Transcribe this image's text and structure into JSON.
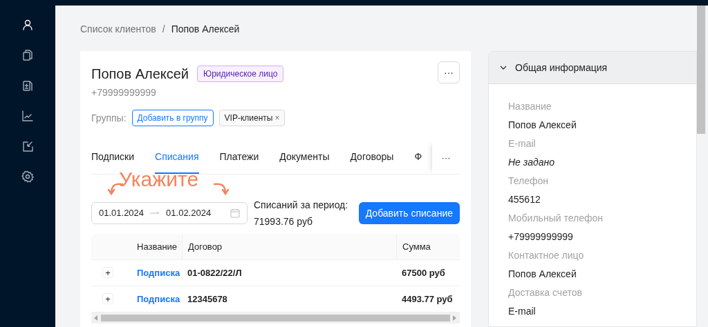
{
  "sidebar": {
    "items": [
      {
        "kind": "user",
        "selected": true
      },
      {
        "kind": "documents",
        "selected": false
      },
      {
        "kind": "invoice",
        "selected": false
      },
      {
        "kind": "chart",
        "selected": false
      },
      {
        "kind": "edit",
        "selected": false
      },
      {
        "kind": "settings",
        "selected": false
      }
    ]
  },
  "breadcrumbs": [
    "Список клиентов",
    "/",
    "Попов Алексей"
  ],
  "client": {
    "name": "Попов Алексей",
    "badge": "Юридическое лицо",
    "phone": "+79999999999",
    "more": "···",
    "groups_label": "Группы:",
    "add_group": "Добавить в группу",
    "groups": [
      {
        "label": "VIP-клиенты",
        "close": "×"
      }
    ]
  },
  "tabs": [
    {
      "label": "Подписки",
      "selected": false
    },
    {
      "label": "Списания",
      "selected": true
    },
    {
      "label": "Платежи",
      "selected": false
    },
    {
      "label": "Документы",
      "selected": false
    },
    {
      "label": "Договоры",
      "selected": false
    },
    {
      "label": "Ф",
      "selected": false
    }
  ],
  "tabs_more": "···",
  "annotation": "Укажите",
  "date_range": {
    "from": "01.01.2024",
    "to": "01.02.2024"
  },
  "period_total": {
    "label": "Списаний за период:",
    "value": "71993.76 руб"
  },
  "add_button": "Добавить списание",
  "table": {
    "columns": [
      "Название",
      "Договор",
      "Сумма"
    ],
    "rows": [
      {
        "expand": "+",
        "name": "Подписка",
        "contract": "01-0822/22/Л",
        "amount": "67500 руб"
      },
      {
        "expand": "+",
        "name": "Подписка",
        "contract": "12345678",
        "amount": "4493.77 руб"
      }
    ]
  },
  "info_panel": {
    "title": "Общая информация",
    "expanded": true,
    "fields": [
      {
        "label": "Название",
        "value": "Попов Алексей",
        "empty": false
      },
      {
        "label": "E-mail",
        "value": "Не задано",
        "empty": true
      },
      {
        "label": "Телефон",
        "value": "455612",
        "empty": false
      },
      {
        "label": "Мобильный телефон",
        "value": "+79999999999",
        "empty": false
      },
      {
        "label": "Контактное лицо",
        "value": "Попов Алексей",
        "empty": false
      },
      {
        "label": "Доставка счетов",
        "value": "E-mail",
        "empty": false
      }
    ]
  }
}
